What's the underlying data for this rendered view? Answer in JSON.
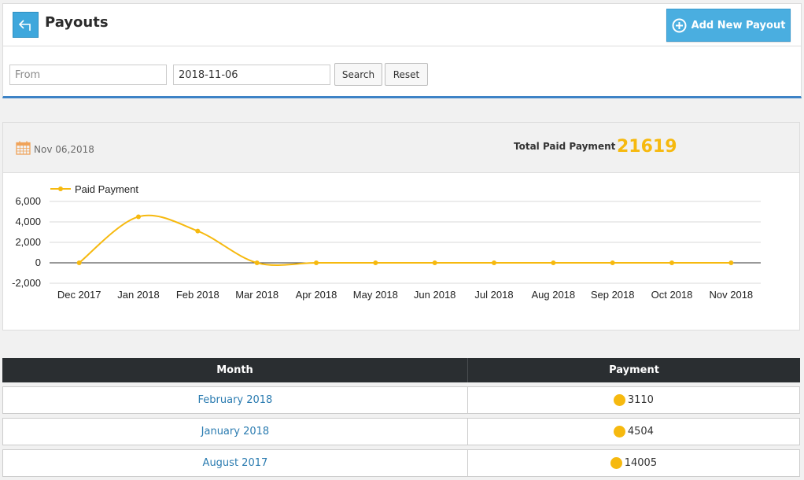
{
  "header": {
    "title": "Payouts",
    "add_button_label": "Add New Payout"
  },
  "filters": {
    "from_placeholder": "From",
    "from_value": "",
    "to_value": "2018-11-06",
    "search_label": "Search",
    "reset_label": "Reset"
  },
  "summary": {
    "date": "Nov 06,2018",
    "total_label": "Total Paid Payment",
    "total_value": "21619"
  },
  "colors": {
    "accent_blue": "#3ea7dc",
    "series_yellow": "#f6b90f",
    "table_header": "#2a2e31"
  },
  "chart_data": {
    "type": "line",
    "categories": [
      "Dec 2017",
      "Jan 2018",
      "Feb 2018",
      "Mar 2018",
      "Apr 2018",
      "May 2018",
      "Jun 2018",
      "Jul 2018",
      "Aug 2018",
      "Sep 2018",
      "Oct 2018",
      "Nov 2018"
    ],
    "series": [
      {
        "name": "Paid Payment",
        "values": [
          0,
          4504,
          3110,
          0,
          0,
          0,
          0,
          0,
          0,
          0,
          0,
          0
        ]
      }
    ],
    "y_ticks": [
      "6,000",
      "4,000",
      "2,000",
      "0",
      "-2,000"
    ],
    "ylim": [
      -2000,
      6000
    ],
    "legend": "top-left",
    "grid": true
  },
  "table": {
    "headers": [
      "Month",
      "Payment"
    ],
    "rows": [
      {
        "month": "February 2018",
        "payment": "3110"
      },
      {
        "month": "January 2018",
        "payment": "4504"
      },
      {
        "month": "August 2017",
        "payment": "14005"
      }
    ]
  }
}
